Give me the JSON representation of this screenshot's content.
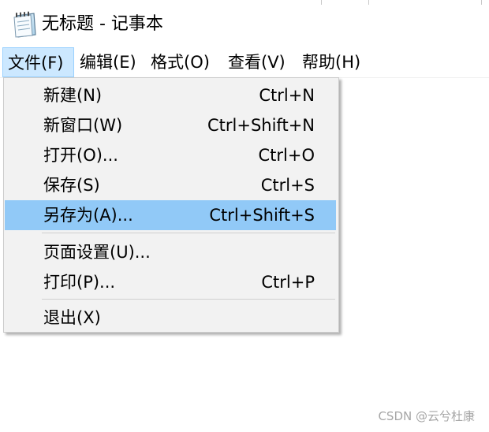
{
  "window": {
    "title": "无标题 - 记事本",
    "icon": "notepad-icon"
  },
  "menubar": {
    "menus": [
      {
        "label": "文件(F)",
        "open": true
      },
      {
        "label": "编辑(E)"
      },
      {
        "label": "格式(O)"
      },
      {
        "label": "查看(V)"
      },
      {
        "label": "帮助(H)"
      }
    ]
  },
  "file_menu": {
    "items": [
      {
        "label": "新建(N)",
        "shortcut": "Ctrl+N"
      },
      {
        "label": "新窗口(W)",
        "shortcut": "Ctrl+Shift+N"
      },
      {
        "label": "打开(O)...",
        "shortcut": "Ctrl+O"
      },
      {
        "label": "保存(S)",
        "shortcut": "Ctrl+S"
      },
      {
        "label": "另存为(A)...",
        "shortcut": "Ctrl+Shift+S",
        "highlighted": true
      },
      {
        "label": "页面设置(U)...",
        "shortcut": ""
      },
      {
        "label": "打印(P)...",
        "shortcut": "Ctrl+P"
      },
      {
        "label": "退出(X)",
        "shortcut": ""
      }
    ]
  },
  "watermark": "CSDN @云兮杜康",
  "colors": {
    "menu_open_bg": "#cce8ff",
    "menu_open_border": "#99d1ff",
    "item_highlight": "#91c9f7",
    "menu_bg": "#f2f2f2"
  }
}
